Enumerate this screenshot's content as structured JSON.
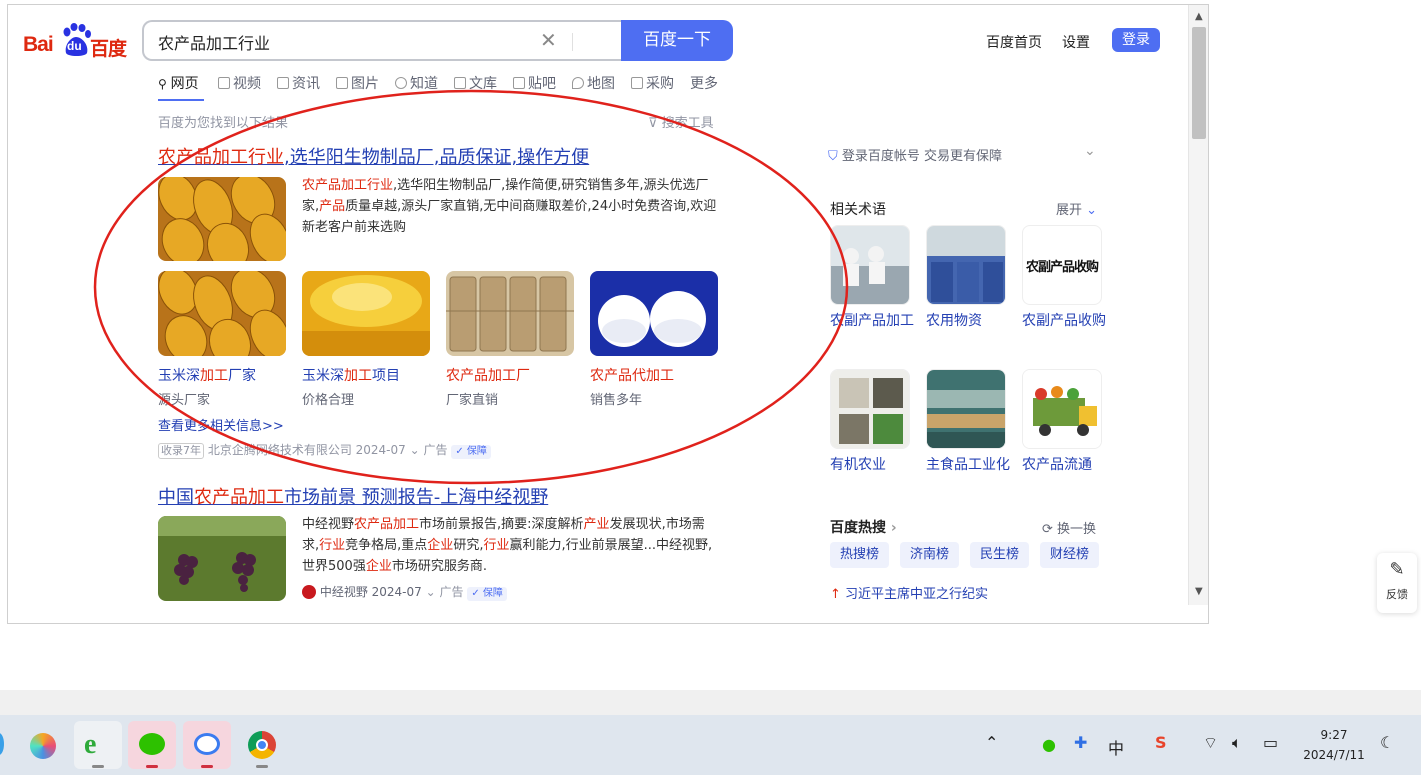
{
  "header": {
    "logo_text_bai": "Bai",
    "logo_text_du": "du",
    "logo_text_baidu": "百度",
    "search_value": "农产品加工行业",
    "search_button": "百度一下",
    "links": [
      "百度首页",
      "设置"
    ],
    "login": "登录"
  },
  "tabs": [
    "网页",
    "视频",
    "资讯",
    "图片",
    "知道",
    "文库",
    "贴吧",
    "地图",
    "采购",
    "更多"
  ],
  "result_count": "百度为您找到以下结果",
  "search_tools": "搜索工具",
  "result1": {
    "title_hl": "农产品加工行业",
    "title_rest": ",选华阳生物制品厂,品质保证,操作方便",
    "desc_hl1": "农产品加工行业",
    "desc_a": ",选华阳生物制品厂,操作简便,研究销售多年,源头优选厂家,",
    "desc_hl2": "产品",
    "desc_b": "质量卓越,源头厂家直销,无中间商赚取差价,24小时免费咨询,欢迎新老客户前来选购",
    "subs": [
      {
        "l1": "玉米深",
        "lh": "加工",
        "l2": "厂家",
        "note": "源头厂家"
      },
      {
        "l1": "玉米深",
        "lh": "加工",
        "l2": "项目",
        "note": "价格合理"
      },
      {
        "l1": "",
        "lh": "农产品加工",
        "l2": "厂",
        "note": "厂家直销"
      },
      {
        "l1": "",
        "lh": "农产品",
        "l2": "代加工",
        "note": "销售多年"
      }
    ],
    "more": "查看更多相关信息>>",
    "meta_badge": "收录7年",
    "meta_company": "北京企腾网络技术有限公司 2024-07",
    "meta_ad": "广告",
    "meta_shield": "保障"
  },
  "result2": {
    "title_a": "中国",
    "title_hl": "农产品加工",
    "title_b": "市场前景 预测报告-上海中经视野",
    "desc_a": "中经视野",
    "desc_hl1": "农产品加工",
    "desc_b": "市场前景报告,摘要:深度解析",
    "desc_hl2": "产业",
    "desc_c": "发展现状,市场需求,",
    "desc_hl3": "行业",
    "desc_d": "竞争格局,重点",
    "desc_hl4": "企业",
    "desc_e": "研究,",
    "desc_hl5": "行业",
    "desc_f": "赢利能力,行业前景展望...中经视野,世界500强",
    "desc_hl6": "企业",
    "desc_g": "市场研究服务商.",
    "meta_company": "中经视野 2024-07",
    "meta_ad": "广告",
    "meta_shield": "保障"
  },
  "right": {
    "login_prompt": "登录百度帐号 交易更有保障",
    "related_title": "相关术语",
    "expand": "展开",
    "terms": [
      "农副产品加工",
      "农用物资",
      "农副产品收购",
      "有机农业",
      "主食品工业化",
      "农产品流通"
    ],
    "term3_img_text": "农副产品收购",
    "hot_title": "百度热搜",
    "refresh": "换一换",
    "hot_tags": [
      "热搜榜",
      "济南榜",
      "民生榜",
      "财经榜"
    ],
    "hot_item": "习近平主席中亚之行纪实"
  },
  "feedback": "反馈",
  "taskbar": {
    "time": "9:27",
    "date": "2024/7/11",
    "ime": "中"
  }
}
